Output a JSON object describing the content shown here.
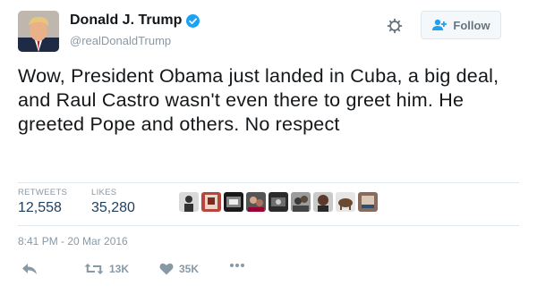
{
  "user": {
    "display_name": "Donald J. Trump",
    "handle": "@realDonaldTrump",
    "verified": true
  },
  "header": {
    "follow_label": "Follow"
  },
  "tweet": {
    "text": "Wow, President Obama just landed in Cuba, a big deal, and Raul Castro wasn't even there to greet him. He greeted Pope and others. No respect"
  },
  "stats": {
    "retweets_label": "RETWEETS",
    "retweets_value": "12,558",
    "likes_label": "LIKES",
    "likes_value": "35,280",
    "liker_avatar_count": 9
  },
  "timestamp": "8:41 PM - 20 Mar 2016",
  "actions": {
    "retweet_count": "13K",
    "like_count": "35K"
  },
  "icons": {
    "verified": "verified-badge-icon",
    "gear": "gear-icon",
    "follow": "add-user-icon",
    "reply": "reply-icon",
    "retweet": "retweet-icon",
    "like": "heart-icon",
    "more": "more-dots-icon"
  },
  "colors": {
    "verified_blue": "#1da1f2",
    "stat_value": "#1d3f5e",
    "muted": "#8899a6"
  }
}
